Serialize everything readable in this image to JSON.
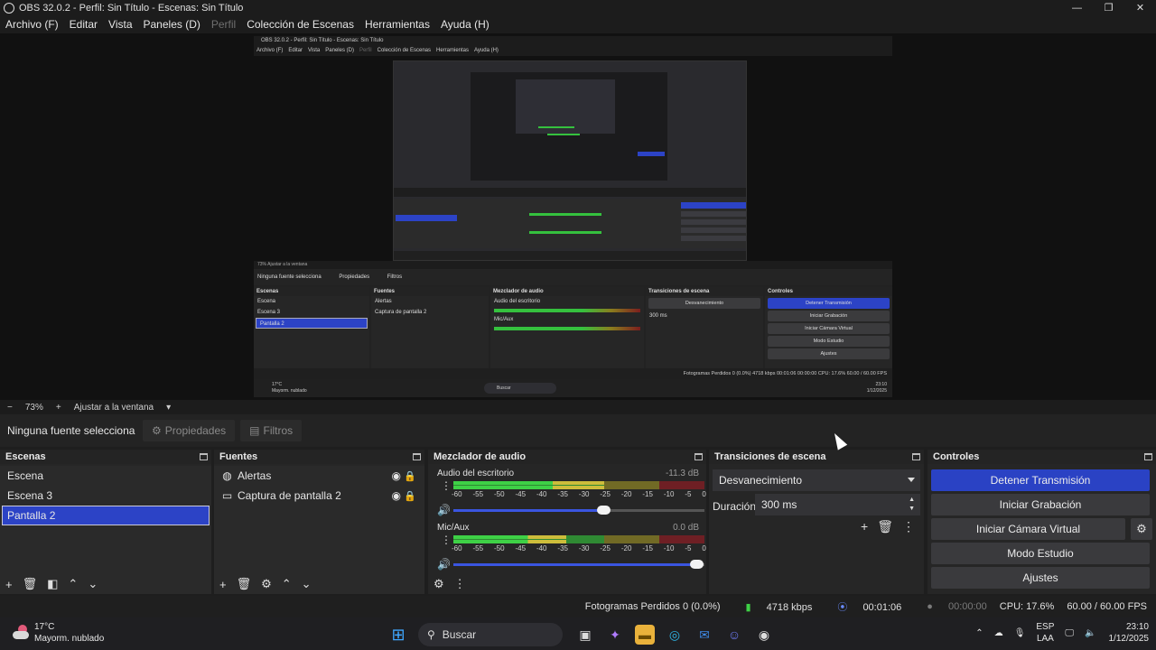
{
  "window": {
    "title": "OBS 32.0.2 - Perfil: Sin Título - Escenas: Sin Título",
    "minimize": "—",
    "maximize": "❐",
    "close": "✕"
  },
  "menu": [
    "Archivo (F)",
    "Editar",
    "Vista",
    "Paneles (D)",
    "Perfil",
    "Colección de Escenas",
    "Herramientas",
    "Ayuda (H)"
  ],
  "zoombar": {
    "minus": "−",
    "zoom": "73%",
    "plus": "+",
    "fit": "Ajustar a la ventana",
    "caret": "▾"
  },
  "source_toolbar": {
    "no_source": "Ninguna fuente selecciona",
    "properties": "Propiedades",
    "filters": "Filtros"
  },
  "scenes": {
    "title": "Escenas",
    "items": [
      "Escena",
      "Escena 3",
      "Pantalla 2"
    ],
    "selected": "Pantalla 2"
  },
  "sources": {
    "title": "Fuentes",
    "items": [
      {
        "label": "Alertas",
        "icon": "browser-icon"
      },
      {
        "label": "Captura de pantalla 2",
        "icon": "monitor-icon"
      }
    ]
  },
  "mixer": {
    "title": "Mezclador de audio",
    "scale": [
      "-60",
      "-55",
      "-50",
      "-45",
      "-40",
      "-35",
      "-30",
      "-25",
      "-20",
      "-15",
      "-10",
      "-5",
      "0"
    ],
    "channels": [
      {
        "name": "Audio del escritorio",
        "db": "-11.3 dB",
        "level": 0.6,
        "volume": 0.6
      },
      {
        "name": "Mic/Aux",
        "db": "0.0 dB",
        "level": 0.45,
        "volume": 0.97
      }
    ]
  },
  "transitions": {
    "title": "Transiciones de escena",
    "selected": "Desvanecimiento",
    "duration_label": "Duración",
    "duration_value": "300 ms"
  },
  "controls": {
    "title": "Controles",
    "stop_stream": "Detener Transmisión",
    "start_record": "Iniciar Grabación",
    "start_virtual_cam": "Iniciar Cámara Virtual",
    "studio_mode": "Modo Estudio",
    "settings": "Ajustes"
  },
  "status": {
    "dropped": "Fotogramas Perdidos 0 (0.0%)",
    "bitrate": "4718 kbps",
    "stream_time": "00:01:06",
    "record_time": "00:00:00",
    "cpu": "CPU: 17.6%",
    "fps": "60.00 / 60.00 FPS"
  },
  "taskbar": {
    "temp": "17°C",
    "weather": "Mayorm. nublado",
    "search": "Buscar",
    "lang1": "ESP",
    "lang2": "LAA",
    "time": "23:10",
    "date": "1/12/2025"
  },
  "nested": {
    "title": "OBS 32.0.2 - Perfil: Sin Título - Escenas: Sin Título",
    "zoom": "73%     Ajustar a la ventana",
    "no_source": "Ninguna fuente selecciona",
    "properties": "Propiedades",
    "filters": "Filtros",
    "scenes_title": "Escenas",
    "sources_title": "Fuentes",
    "mixer_title": "Mezclador de audio",
    "trans_title": "Transiciones de escena",
    "ctrl_title": "Controles",
    "desktop_audio": "Audio del escritorio",
    "desktop_db": "-11.3 dB",
    "mic": "Mic/Aux",
    "mic_db": "0.0 dB",
    "fade": "Desvanecimiento",
    "duration": "Duración",
    "duration_value": "300 ms",
    "status": "Fotogramas Perdidos 0 (0.0%)   4718 kbps   00:01:06   00:00:00   CPU: 17.6%   60.00 / 60.00 FPS",
    "search": "Buscar",
    "temp": "17°C",
    "weather": "Mayorm. nublado",
    "time": "23:10",
    "date": "1/12/2025",
    "lang1": "ESP",
    "lang2": "LAA"
  },
  "colors": {
    "accent": "#2c43c6",
    "meter_green": "#3ed146",
    "meter_yellow": "#cdbd3b",
    "meter_red": "#6e1f24"
  }
}
